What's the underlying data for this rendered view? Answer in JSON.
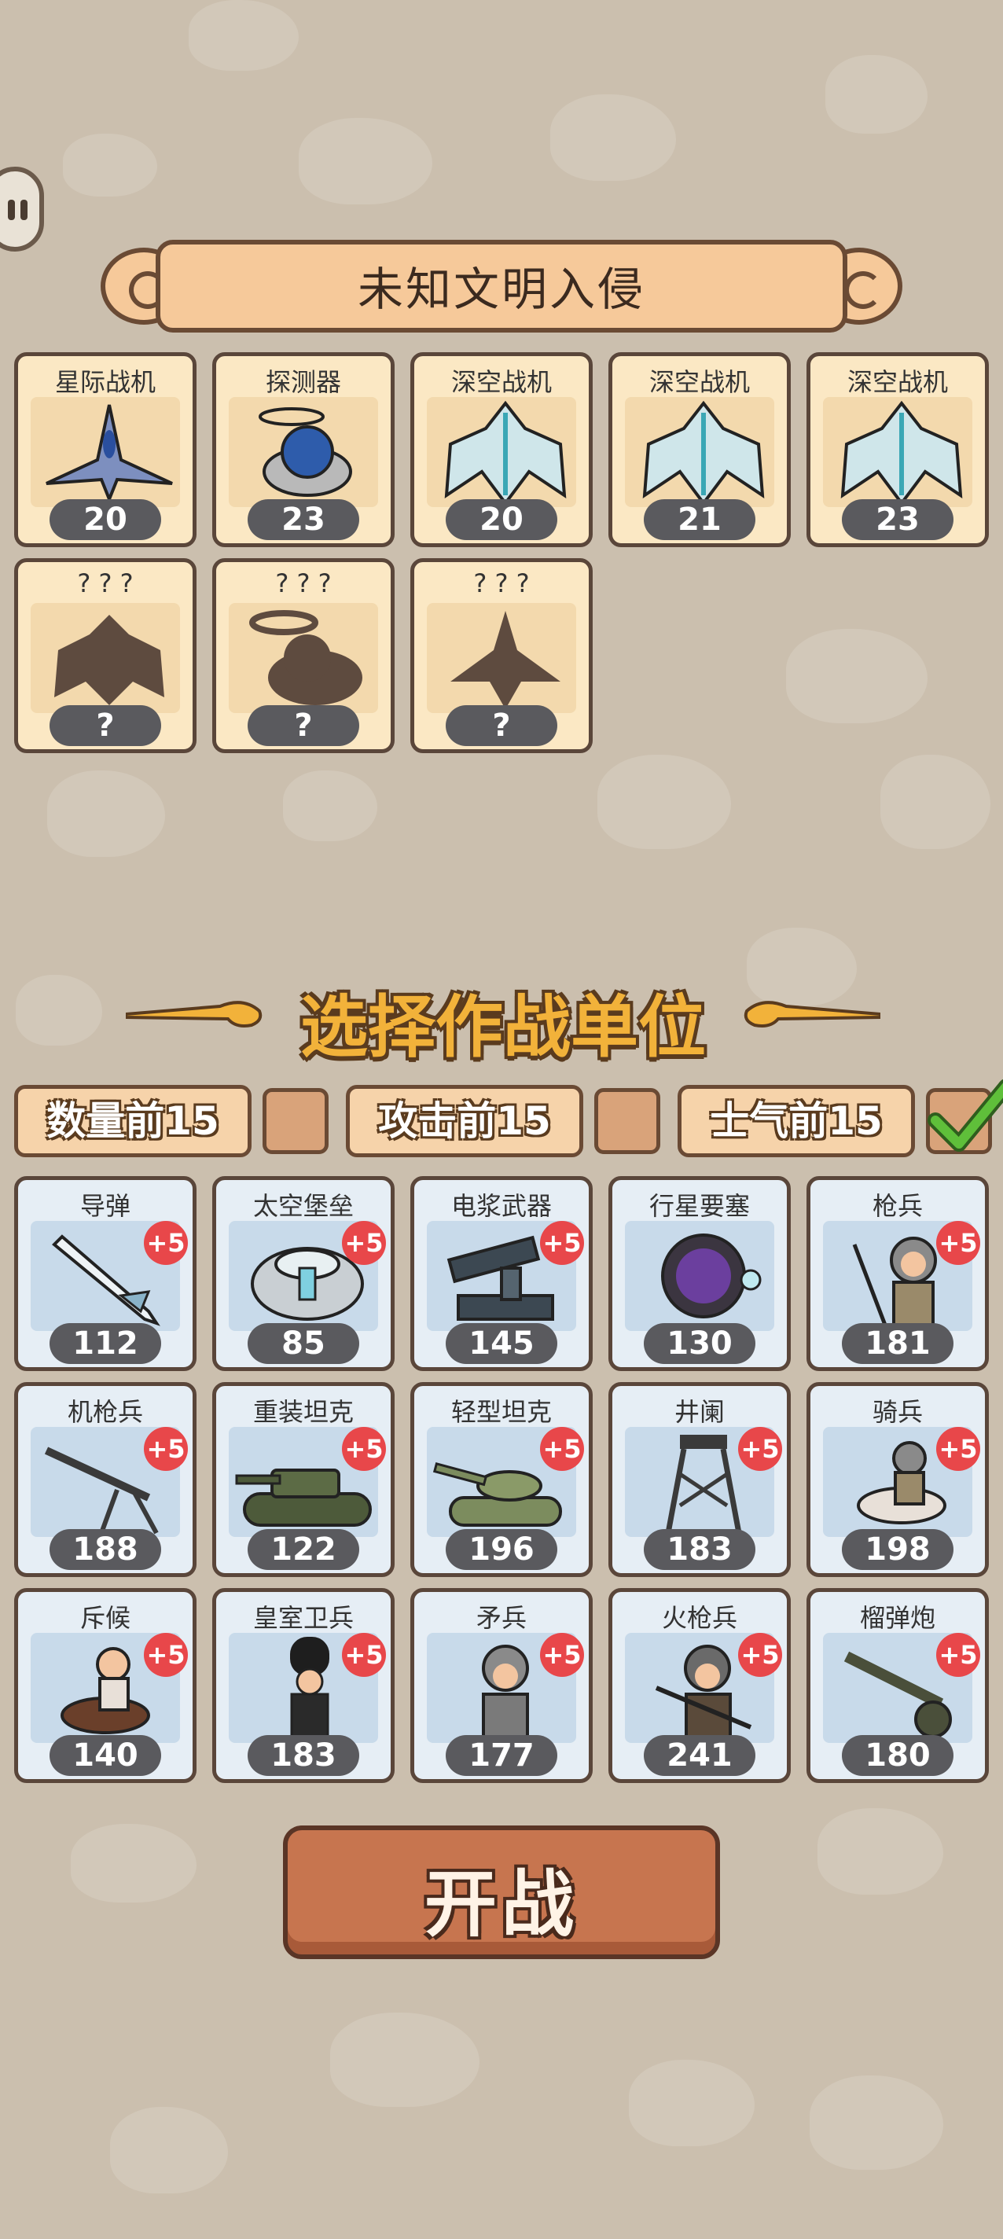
{
  "header": {
    "title": "未知文明入侵"
  },
  "enemies": [
    {
      "name": "星际战机",
      "value": "20",
      "icon": "fighter-jet-icon"
    },
    {
      "name": "探测器",
      "value": "23",
      "icon": "probe-icon"
    },
    {
      "name": "深空战机",
      "value": "20",
      "icon": "deep-space-fighter-icon"
    },
    {
      "name": "深空战机",
      "value": "21",
      "icon": "deep-space-fighter-icon"
    },
    {
      "name": "深空战机",
      "value": "23",
      "icon": "deep-space-fighter-icon"
    },
    {
      "name": "? ? ?",
      "value": "?",
      "icon": "unknown-silhouette-icon"
    },
    {
      "name": "? ? ?",
      "value": "?",
      "icon": "unknown-silhouette-icon"
    },
    {
      "name": "? ? ?",
      "value": "?",
      "icon": "unknown-silhouette-icon"
    }
  ],
  "section": {
    "title": "选择作战单位"
  },
  "filters": [
    {
      "label": "数量前15",
      "checked": false
    },
    {
      "label": "攻击前15",
      "checked": false
    },
    {
      "label": "士气前15",
      "checked": true
    }
  ],
  "units": [
    {
      "name": "导弹",
      "value": "112",
      "bonus": "+5",
      "icon": "missile-icon"
    },
    {
      "name": "太空堡垒",
      "value": "85",
      "bonus": "+5",
      "icon": "space-fortress-icon"
    },
    {
      "name": "电浆武器",
      "value": "145",
      "bonus": "+5",
      "icon": "plasma-weapon-icon"
    },
    {
      "name": "行星要塞",
      "value": "130",
      "bonus": "",
      "icon": "planet-fortress-icon"
    },
    {
      "name": "枪兵",
      "value": "181",
      "bonus": "+5",
      "icon": "spearman-icon"
    },
    {
      "name": "机枪兵",
      "value": "188",
      "bonus": "+5",
      "icon": "machine-gunner-icon"
    },
    {
      "name": "重装坦克",
      "value": "122",
      "bonus": "+5",
      "icon": "heavy-tank-icon"
    },
    {
      "name": "轻型坦克",
      "value": "196",
      "bonus": "+5",
      "icon": "light-tank-icon"
    },
    {
      "name": "井阑",
      "value": "183",
      "bonus": "+5",
      "icon": "siege-tower-icon"
    },
    {
      "name": "骑兵",
      "value": "198",
      "bonus": "+5",
      "icon": "cavalry-icon"
    },
    {
      "name": "斥候",
      "value": "140",
      "bonus": "+5",
      "icon": "scout-icon"
    },
    {
      "name": "皇室卫兵",
      "value": "183",
      "bonus": "+5",
      "icon": "royal-guard-icon"
    },
    {
      "name": "矛兵",
      "value": "177",
      "bonus": "+5",
      "icon": "lancer-icon"
    },
    {
      "name": "火枪兵",
      "value": "241",
      "bonus": "+5",
      "icon": "musketeer-icon"
    },
    {
      "name": "榴弹炮",
      "value": "180",
      "bonus": "+5",
      "icon": "howitzer-icon"
    }
  ],
  "start_button": {
    "label": "开战"
  },
  "colors": {
    "background": "#cbbfae",
    "accent": "#f2b23a",
    "bonus": "#e8474a",
    "check": "#5fbf3a"
  }
}
